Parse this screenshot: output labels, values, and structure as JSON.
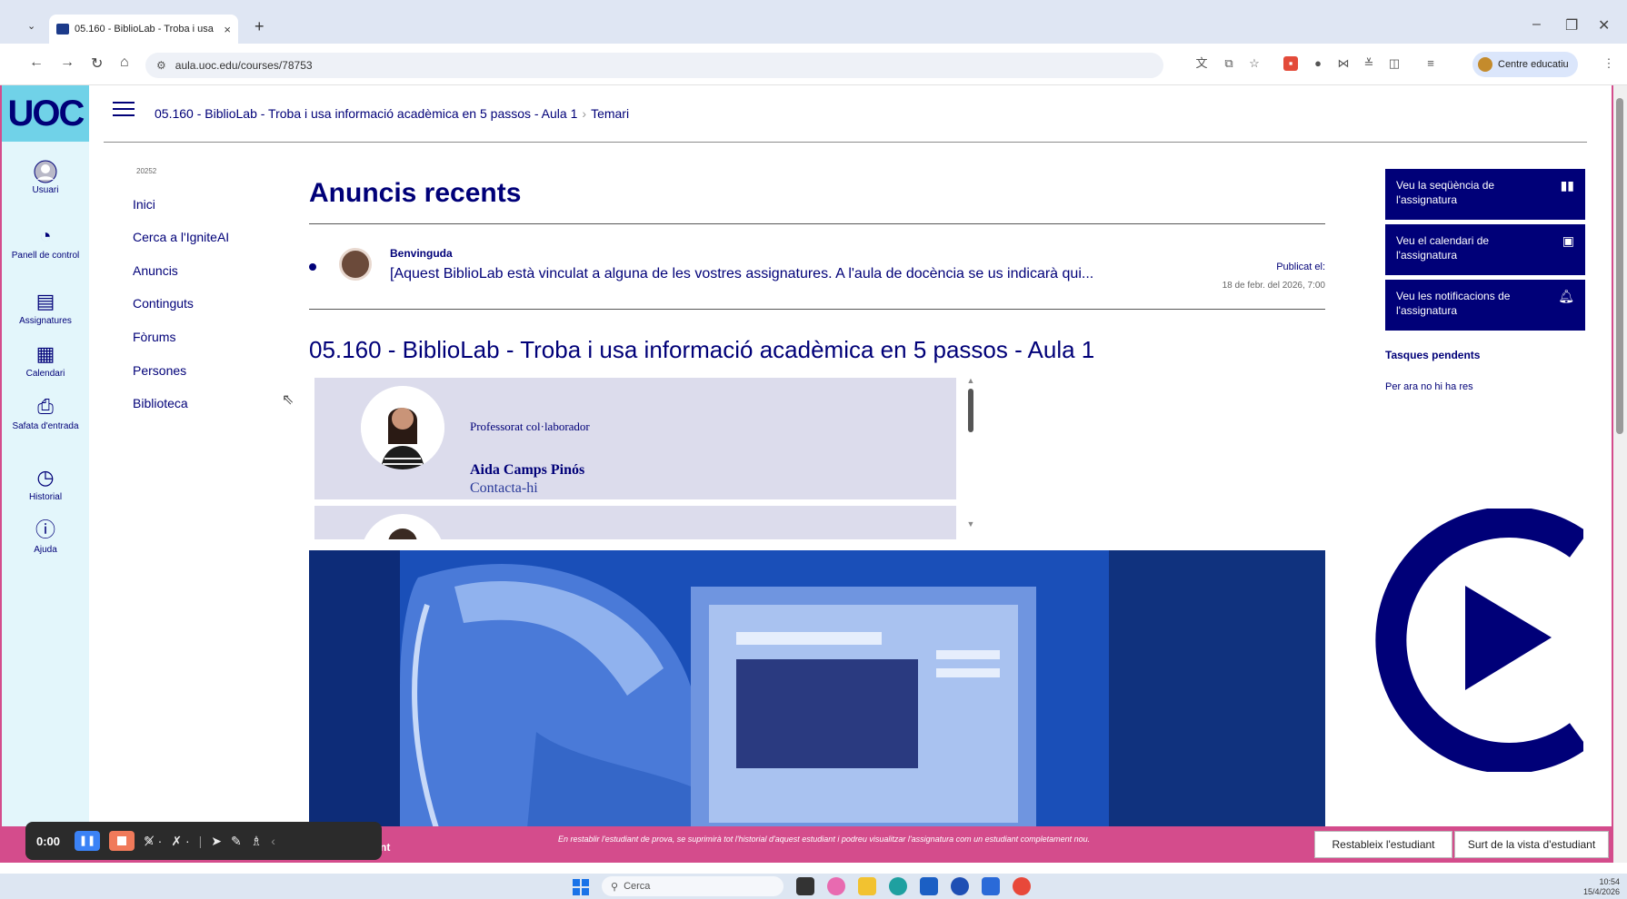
{
  "browser": {
    "tab_title": "05.160 - BiblioLab - Troba i usa",
    "tab_close": "×",
    "new_tab": "+",
    "tab_menu": "⌄",
    "url": "aula.uoc.edu/courses/78753",
    "profile_label": "Centre educatiu",
    "window": {
      "minimize": "–",
      "restore": "❐",
      "close": "✕"
    }
  },
  "rail": {
    "logo": "UOC",
    "items": [
      {
        "label": "Usuari",
        "icon": "user-icon"
      },
      {
        "label": "Panell de control",
        "icon": "dashboard-icon"
      },
      {
        "label": "Assignatures",
        "icon": "courses-icon"
      },
      {
        "label": "Calendari",
        "icon": "calendar-icon"
      },
      {
        "label": "Safata d'entrada",
        "icon": "inbox-icon"
      },
      {
        "label": "Historial",
        "icon": "history-icon"
      },
      {
        "label": "Ajuda",
        "icon": "help-icon"
      }
    ]
  },
  "breadcrumb": {
    "course": "05.160 - BiblioLab - Troba i usa informació acadèmica en 5 passos - Aula 1",
    "separator": "›",
    "current": "Temari"
  },
  "course_menu": {
    "semester": "20252",
    "items": [
      "Inici",
      "Cerca a l'IgniteAI",
      "Anuncis",
      "Continguts",
      "Fòrums",
      "Persones",
      "Biblioteca"
    ]
  },
  "announcements": {
    "title": "Anuncis recents",
    "item": {
      "heading": "Benvinguda",
      "body": "[Aquest BiblioLab està vinculat a alguna de les vostres assignatures. A l'aula de docència se us indicarà qui...",
      "published_label": "Publicat el:",
      "published_date": "18 de febr. del 2026, 7:00"
    }
  },
  "course_title": "05.160 - BiblioLab - Troba i usa informació acadèmica en 5 passos - Aula 1",
  "teacher": {
    "role": "Professorat col·laborador",
    "name": "Aida Camps Pinós",
    "contact": "Contacta-hi"
  },
  "right_column": {
    "buttons": [
      {
        "label": "Veu la seqüència de l'assignatura",
        "icon": "chart-icon"
      },
      {
        "label": "Veu el calendari de l'assignatura",
        "icon": "calendar-icon"
      },
      {
        "label": "Veu les notificacions de l'assignatura",
        "icon": "bell-icon"
      }
    ],
    "tasks_title": "Tasques pendents",
    "tasks_empty": "Per ara no hi ha res"
  },
  "student_bar": {
    "prefix": "nt",
    "message": "En restablir l'estudiant de prova, se suprimirà tot l'historial d'aquest estudiant i podreu visualitzar l'assignatura com un estudiant completament nou.",
    "reset_label": "Restableix l'estudiant",
    "exit_label": "Surt de la vista d'estudiant"
  },
  "recorder": {
    "time": "0:00"
  },
  "taskbar": {
    "search_placeholder": "Cerca",
    "clock_time": "10:54",
    "clock_date": "15/4/2026"
  },
  "colors": {
    "brand": "#000078",
    "accent_pink": "#d44c8c",
    "logo_cyan": "#70d2e8",
    "rail_bg": "#e3f6fb"
  }
}
